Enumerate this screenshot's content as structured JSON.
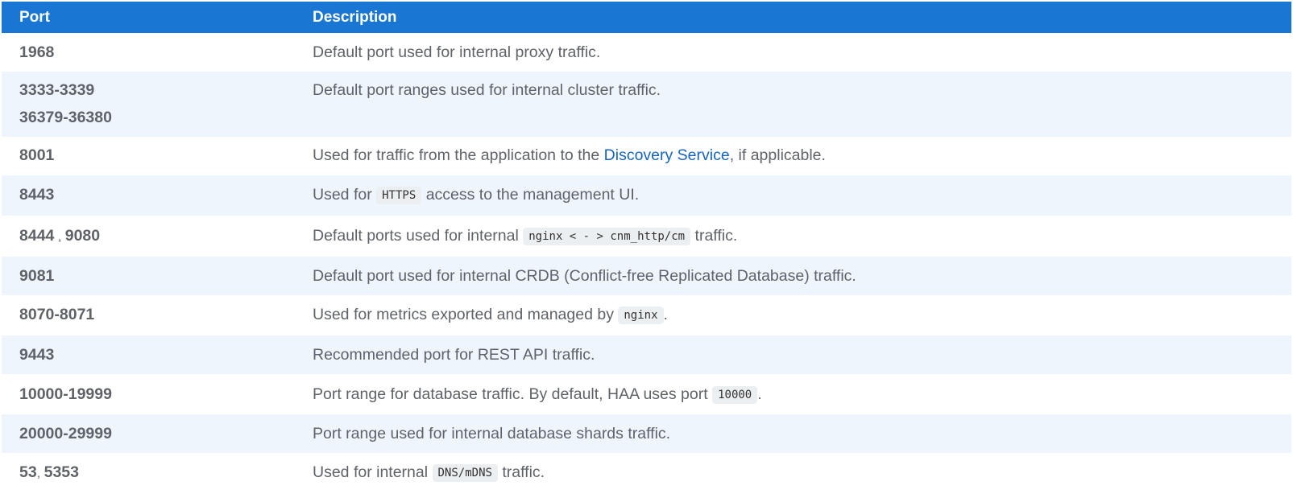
{
  "table": {
    "headers": {
      "port": "Port",
      "description": "Description"
    },
    "rows": [
      {
        "ports": [
          "1968"
        ],
        "desc": "Default port used for internal proxy traffic."
      },
      {
        "ports": [
          "3333-3339",
          "36379-36380"
        ],
        "desc": "Default port ranges used for internal cluster traffic."
      },
      {
        "ports": [
          "8001"
        ],
        "desc_before": "Used for traffic from the application to the ",
        "link": "Discovery Service",
        "desc_after": ", if applicable."
      },
      {
        "ports": [
          "8443"
        ],
        "desc_before": "Used for ",
        "code": "HTTPS",
        "desc_after": " access to the management UI."
      },
      {
        "port_a": "8444",
        "port_sep": " , ",
        "port_b": "9080",
        "desc_before": "Default ports used for internal ",
        "code": "nginx < - > cnm_http/cm",
        "desc_after": " traffic."
      },
      {
        "ports": [
          "9081"
        ],
        "desc": "Default port used for internal CRDB (Conflict-free Replicated Database) traffic."
      },
      {
        "ports": [
          "8070-8071"
        ],
        "desc_before": "Used for metrics exported and managed by ",
        "code": "nginx",
        "desc_after": "."
      },
      {
        "ports": [
          "9443"
        ],
        "desc": "Recommended port for REST API traffic."
      },
      {
        "ports": [
          "10000-19999"
        ],
        "desc_before": "Port range for database traffic. By default, HAA uses port ",
        "code": "10000",
        "desc_after": "."
      },
      {
        "ports": [
          "20000-29999"
        ],
        "desc": "Port range used for internal database shards traffic."
      },
      {
        "port_a": "53",
        "port_sep": ", ",
        "port_b": "5353",
        "desc_before": "Used for internal ",
        "code": "DNS/mDNS",
        "desc_after": " traffic."
      }
    ]
  },
  "colors": {
    "header_bg": "#1976d2",
    "stripe_bg": "#eef5fd",
    "link": "#1565c0",
    "text": "#5f6368"
  }
}
